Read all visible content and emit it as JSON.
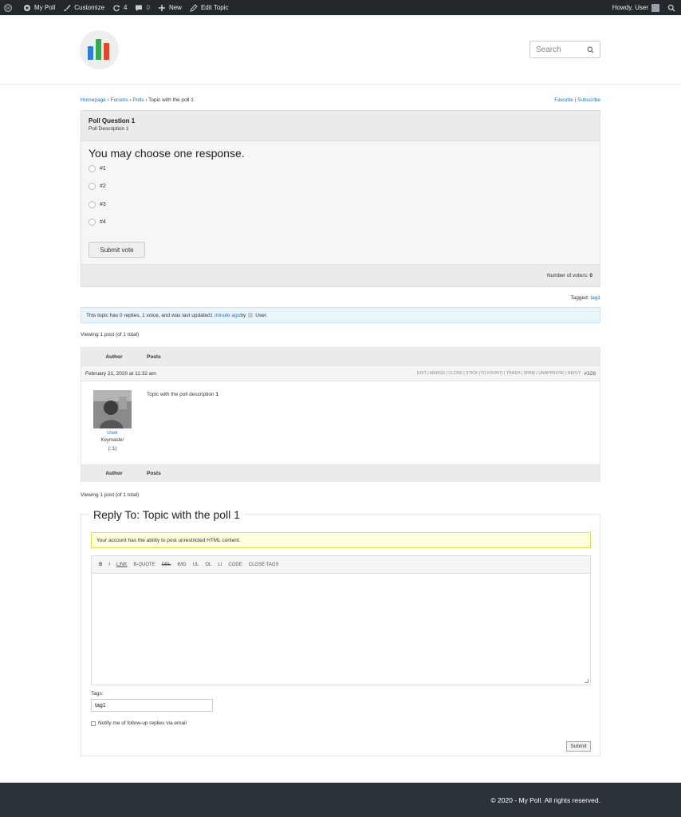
{
  "admin_bar": {
    "site_name": "My Poll",
    "customize": "Customize",
    "updates_count": "4",
    "comments_count": "0",
    "new_label": "New",
    "edit_topic": "Edit Topic",
    "howdy": "Howdy, User"
  },
  "header": {
    "search_placeholder": "Search"
  },
  "breadcrumb": {
    "home": "Homepage",
    "sep": " › ",
    "forums": "Forums",
    "polls": "Polls",
    "current": "Topic with the poll 1"
  },
  "topic_actions": {
    "favorite": "Favorite",
    "separator": " | ",
    "subscribe": "Subscribe"
  },
  "poll": {
    "question": "Poll Question 1",
    "description": "Poll Description 1",
    "prompt": "You may choose one response.",
    "options": [
      "#1",
      "#2",
      "#3",
      "#4"
    ],
    "submit_label": "Submit vote",
    "voters_label": "Number of voters: ",
    "voters_count": "0"
  },
  "tags": {
    "label": "Tagged: ",
    "tag": "tag1"
  },
  "topic_info": {
    "text_before": "This topic has 0 replies, 1 voice, and was last updated ",
    "time_link": "1 minute ago",
    "by": " by ",
    "user": "User."
  },
  "viewing": "Viewing 1 post (of 1 total)",
  "post_table": {
    "col_author": "Author",
    "col_posts": "Posts",
    "date": "February 21, 2020 at 11:32 am",
    "admin_links": "EDIT | MERGE | CLOSE | STICK (TO FRONT) | TRASH | SPAM | UNAPPROVE | REPLY",
    "post_id": "#328",
    "author_name": "User",
    "author_role": "Keymaster",
    "author_ip": "(::1)",
    "content_text": "Topic with the poll description ",
    "content_bold": "1"
  },
  "reply": {
    "legend": "Reply To: Topic with the poll 1",
    "html_notice": "Your account has the ability to post unrestricted HTML content.",
    "quicktags": [
      "B",
      "I",
      "LINK",
      "B-QUOTE",
      "DEL",
      "IMG",
      "UL",
      "OL",
      "LI",
      "CODE",
      "CLOSE TAGS"
    ],
    "tags_label": "Tags:",
    "tags_value": "tag1",
    "notify_label": "Notify me of follow-up replies via email",
    "submit_label": "Submit"
  },
  "footer": {
    "copyright": "© 2020 - My Poll. All rights reserved."
  },
  "colors": {
    "link": "#1e73be",
    "adminbar": "#23282d",
    "footer": "#2c3239",
    "logo_blue": "#2a7fdc",
    "logo_green": "#38a853",
    "logo_red": "#e4472f"
  }
}
